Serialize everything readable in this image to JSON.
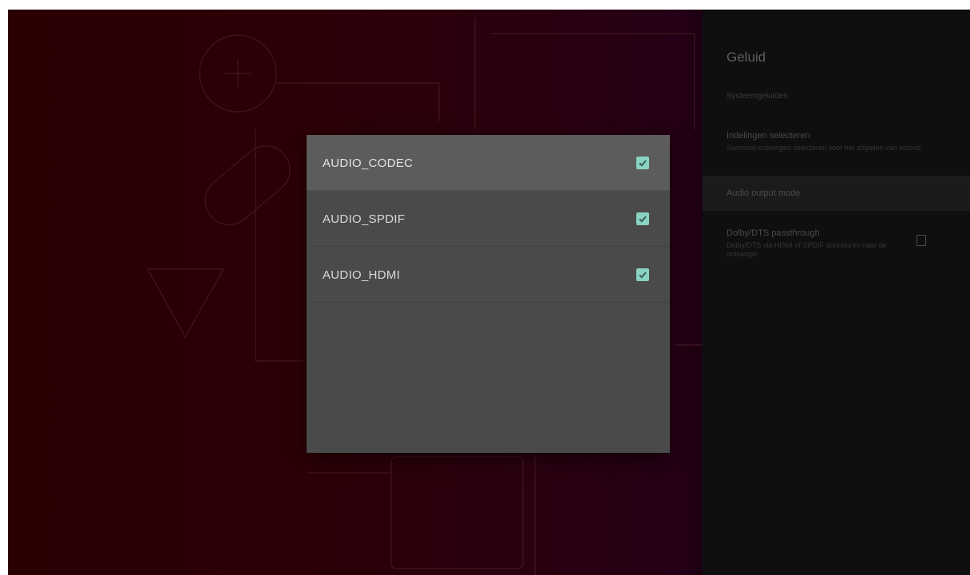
{
  "side_panel": {
    "title": "Geluid",
    "subtitle": "Systeemgeluiden",
    "items": [
      {
        "title": "Indelingen selecteren",
        "description": "Surround-indelingen selecteren voor het afspelen van inhoud"
      },
      {
        "title": "Audio output mode",
        "description": ""
      },
      {
        "title": "Dolby/DTS passthrough",
        "description": "Dolby/DTS via HDMI of SPDIF doorsturen naar de ontvanger"
      }
    ],
    "passthrough_checked": false
  },
  "dialog": {
    "options": [
      {
        "label": "AUDIO_CODEC",
        "checked": true
      },
      {
        "label": "AUDIO_SPDIF",
        "checked": true
      },
      {
        "label": "AUDIO_HDMI",
        "checked": true
      }
    ]
  },
  "colors": {
    "accent_checkbox": "#8ad3c2",
    "dialog_bg": "#4a4a4a",
    "focused_row": "#5c5c5c",
    "background": "#2a0003"
  }
}
